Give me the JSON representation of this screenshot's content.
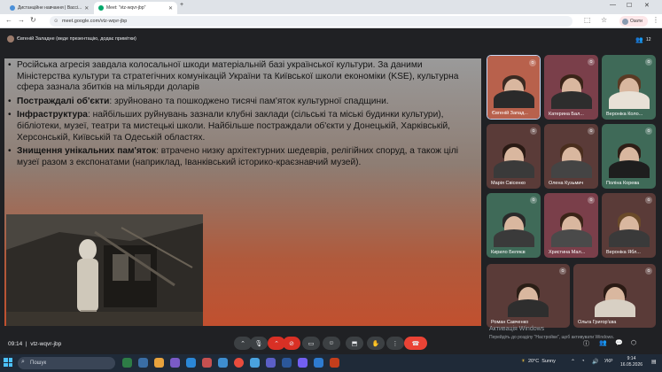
{
  "browser": {
    "tabs": [
      {
        "label": "Дистанційне навчання | Вассі...",
        "active": false
      },
      {
        "label": "Meet: \"vtz-wqvr-jbp\"",
        "active": true
      }
    ],
    "new_tab": "+",
    "url": "meet.google.com/vtz-wqvr-jbp",
    "profile_label": "Озати"
  },
  "meet": {
    "presenter_label": "Євгеній Заладне (веде презентацію, додає примітки)",
    "participant_count": "12",
    "meeting_code": "vtz-wqvr-jbp",
    "time": "09:14"
  },
  "slide": {
    "bullets": [
      {
        "bold": "",
        "text": "Російська агресія завдала колосальної шкоди матеріальній базі української культури. За даними Міністерства культури та стратегічних комунікацій України та Київської школи економіки (KSE), культурна сфера зазнала збитків на мільярди доларів"
      },
      {
        "bold": "Постраждалі об'єкти",
        "text": ": зруйновано та пошкоджено тисячі пам'яток культурної спадщини."
      },
      {
        "bold": "Інфраструктура",
        "text": ": найбільших руйнувань зазнали клубні заклади (сільські та міські будинки культури), бібліотеки, музеї, театри та мистецькі школи. Найбільше постраждали об'єкти у Донецькій, Харківській, Херсонській, Київській та Одеській областях."
      },
      {
        "bold": "Знищення унікальних пам'яток",
        "text": ": втрачено низку архітектурних шедеврів, релігійних споруд, а також цілі музеї разом з експонатами (наприклад, Іванківський історико-краєзнавчий музей)."
      }
    ]
  },
  "participants": [
    {
      "name": "Євгеній Запад...",
      "bg": "#b8614c",
      "hair": "#3b2a22",
      "shirt": "#2a2a2a"
    },
    {
      "name": "Катерина Бал...",
      "bg": "#7a3f4a",
      "hair": "#3a2418",
      "shirt": "#2d2d2d"
    },
    {
      "name": "Вероніка Коло...",
      "bg": "#3f6a58",
      "hair": "#5a3a24",
      "shirt": "#e8e1d6"
    },
    {
      "name": "Марія Свісенко",
      "bg": "#5a3b38",
      "hair": "#2a1a14",
      "shirt": "#3a3a3a"
    },
    {
      "name": "Олена Кузьмич",
      "bg": "#5a3b38",
      "hair": "#4a2e1e",
      "shirt": "#444444"
    },
    {
      "name": "Поліна Корева",
      "bg": "#3f6a58",
      "hair": "#2e1e16",
      "shirt": "#1e1e1e"
    },
    {
      "name": "Кирило Беляєв",
      "bg": "#3f6a58",
      "hair": "#2a2a2a",
      "shirt": "#3a3a3a"
    },
    {
      "name": "Христина Мал...",
      "bg": "#7a3f4a",
      "hair": "#3b2418",
      "shirt": "#4a4a4a"
    },
    {
      "name": "Вероніка Ябл...",
      "bg": "#5a3b38",
      "hair": "#6a4a2a",
      "shirt": "#3a3a3a"
    },
    {
      "name": "Роман Савченко",
      "bg": "#5a3b38",
      "hair": "#2a1e16",
      "shirt": "#2e2e2e"
    },
    {
      "name": "Ольга Григор'єва",
      "bg": "#5a3b38",
      "hair": "#2a1a14",
      "shirt": "#d8d0c4"
    }
  ],
  "watermark": {
    "line1": "Активація Windows",
    "line2": "Перейдіть до розділу \"Настройки\", щоб активувати Windows."
  },
  "taskbar": {
    "search_placeholder": "Пошук",
    "weather": "20°C",
    "weather_desc": "Sunny",
    "clock_time": "9:14",
    "clock_date": "16.05.2026"
  },
  "colors": {
    "hangup": "#ea4335",
    "cam_off": "#d93025",
    "accent": "#4cc2ff"
  }
}
